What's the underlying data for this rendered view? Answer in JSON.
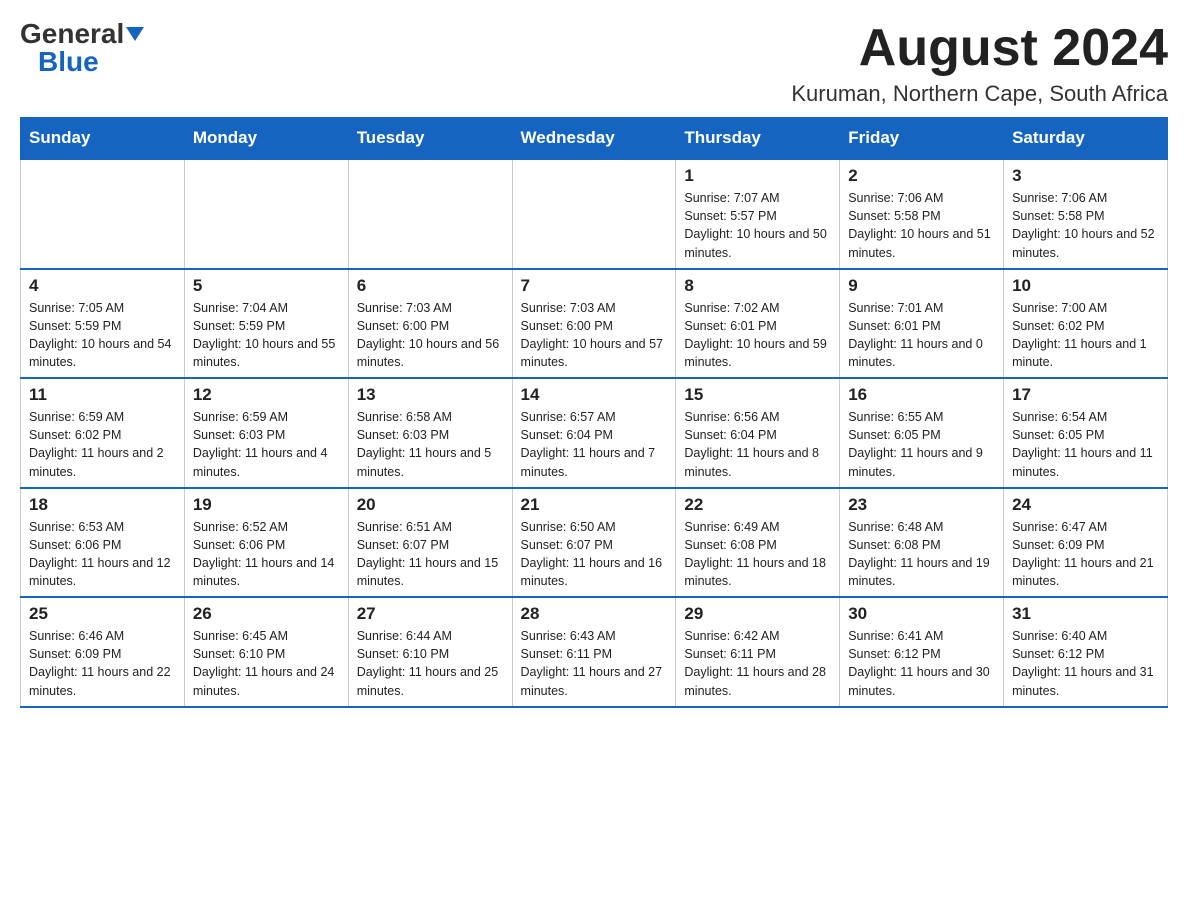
{
  "logo": {
    "general": "General",
    "blue": "Blue"
  },
  "title": {
    "month": "August 2024",
    "location": "Kuruman, Northern Cape, South Africa"
  },
  "weekdays": [
    "Sunday",
    "Monday",
    "Tuesday",
    "Wednesday",
    "Thursday",
    "Friday",
    "Saturday"
  ],
  "weeks": [
    [
      {
        "day": "",
        "info": ""
      },
      {
        "day": "",
        "info": ""
      },
      {
        "day": "",
        "info": ""
      },
      {
        "day": "",
        "info": ""
      },
      {
        "day": "1",
        "info": "Sunrise: 7:07 AM\nSunset: 5:57 PM\nDaylight: 10 hours and 50 minutes."
      },
      {
        "day": "2",
        "info": "Sunrise: 7:06 AM\nSunset: 5:58 PM\nDaylight: 10 hours and 51 minutes."
      },
      {
        "day": "3",
        "info": "Sunrise: 7:06 AM\nSunset: 5:58 PM\nDaylight: 10 hours and 52 minutes."
      }
    ],
    [
      {
        "day": "4",
        "info": "Sunrise: 7:05 AM\nSunset: 5:59 PM\nDaylight: 10 hours and 54 minutes."
      },
      {
        "day": "5",
        "info": "Sunrise: 7:04 AM\nSunset: 5:59 PM\nDaylight: 10 hours and 55 minutes."
      },
      {
        "day": "6",
        "info": "Sunrise: 7:03 AM\nSunset: 6:00 PM\nDaylight: 10 hours and 56 minutes."
      },
      {
        "day": "7",
        "info": "Sunrise: 7:03 AM\nSunset: 6:00 PM\nDaylight: 10 hours and 57 minutes."
      },
      {
        "day": "8",
        "info": "Sunrise: 7:02 AM\nSunset: 6:01 PM\nDaylight: 10 hours and 59 minutes."
      },
      {
        "day": "9",
        "info": "Sunrise: 7:01 AM\nSunset: 6:01 PM\nDaylight: 11 hours and 0 minutes."
      },
      {
        "day": "10",
        "info": "Sunrise: 7:00 AM\nSunset: 6:02 PM\nDaylight: 11 hours and 1 minute."
      }
    ],
    [
      {
        "day": "11",
        "info": "Sunrise: 6:59 AM\nSunset: 6:02 PM\nDaylight: 11 hours and 2 minutes."
      },
      {
        "day": "12",
        "info": "Sunrise: 6:59 AM\nSunset: 6:03 PM\nDaylight: 11 hours and 4 minutes."
      },
      {
        "day": "13",
        "info": "Sunrise: 6:58 AM\nSunset: 6:03 PM\nDaylight: 11 hours and 5 minutes."
      },
      {
        "day": "14",
        "info": "Sunrise: 6:57 AM\nSunset: 6:04 PM\nDaylight: 11 hours and 7 minutes."
      },
      {
        "day": "15",
        "info": "Sunrise: 6:56 AM\nSunset: 6:04 PM\nDaylight: 11 hours and 8 minutes."
      },
      {
        "day": "16",
        "info": "Sunrise: 6:55 AM\nSunset: 6:05 PM\nDaylight: 11 hours and 9 minutes."
      },
      {
        "day": "17",
        "info": "Sunrise: 6:54 AM\nSunset: 6:05 PM\nDaylight: 11 hours and 11 minutes."
      }
    ],
    [
      {
        "day": "18",
        "info": "Sunrise: 6:53 AM\nSunset: 6:06 PM\nDaylight: 11 hours and 12 minutes."
      },
      {
        "day": "19",
        "info": "Sunrise: 6:52 AM\nSunset: 6:06 PM\nDaylight: 11 hours and 14 minutes."
      },
      {
        "day": "20",
        "info": "Sunrise: 6:51 AM\nSunset: 6:07 PM\nDaylight: 11 hours and 15 minutes."
      },
      {
        "day": "21",
        "info": "Sunrise: 6:50 AM\nSunset: 6:07 PM\nDaylight: 11 hours and 16 minutes."
      },
      {
        "day": "22",
        "info": "Sunrise: 6:49 AM\nSunset: 6:08 PM\nDaylight: 11 hours and 18 minutes."
      },
      {
        "day": "23",
        "info": "Sunrise: 6:48 AM\nSunset: 6:08 PM\nDaylight: 11 hours and 19 minutes."
      },
      {
        "day": "24",
        "info": "Sunrise: 6:47 AM\nSunset: 6:09 PM\nDaylight: 11 hours and 21 minutes."
      }
    ],
    [
      {
        "day": "25",
        "info": "Sunrise: 6:46 AM\nSunset: 6:09 PM\nDaylight: 11 hours and 22 minutes."
      },
      {
        "day": "26",
        "info": "Sunrise: 6:45 AM\nSunset: 6:10 PM\nDaylight: 11 hours and 24 minutes."
      },
      {
        "day": "27",
        "info": "Sunrise: 6:44 AM\nSunset: 6:10 PM\nDaylight: 11 hours and 25 minutes."
      },
      {
        "day": "28",
        "info": "Sunrise: 6:43 AM\nSunset: 6:11 PM\nDaylight: 11 hours and 27 minutes."
      },
      {
        "day": "29",
        "info": "Sunrise: 6:42 AM\nSunset: 6:11 PM\nDaylight: 11 hours and 28 minutes."
      },
      {
        "day": "30",
        "info": "Sunrise: 6:41 AM\nSunset: 6:12 PM\nDaylight: 11 hours and 30 minutes."
      },
      {
        "day": "31",
        "info": "Sunrise: 6:40 AM\nSunset: 6:12 PM\nDaylight: 11 hours and 31 minutes."
      }
    ]
  ]
}
